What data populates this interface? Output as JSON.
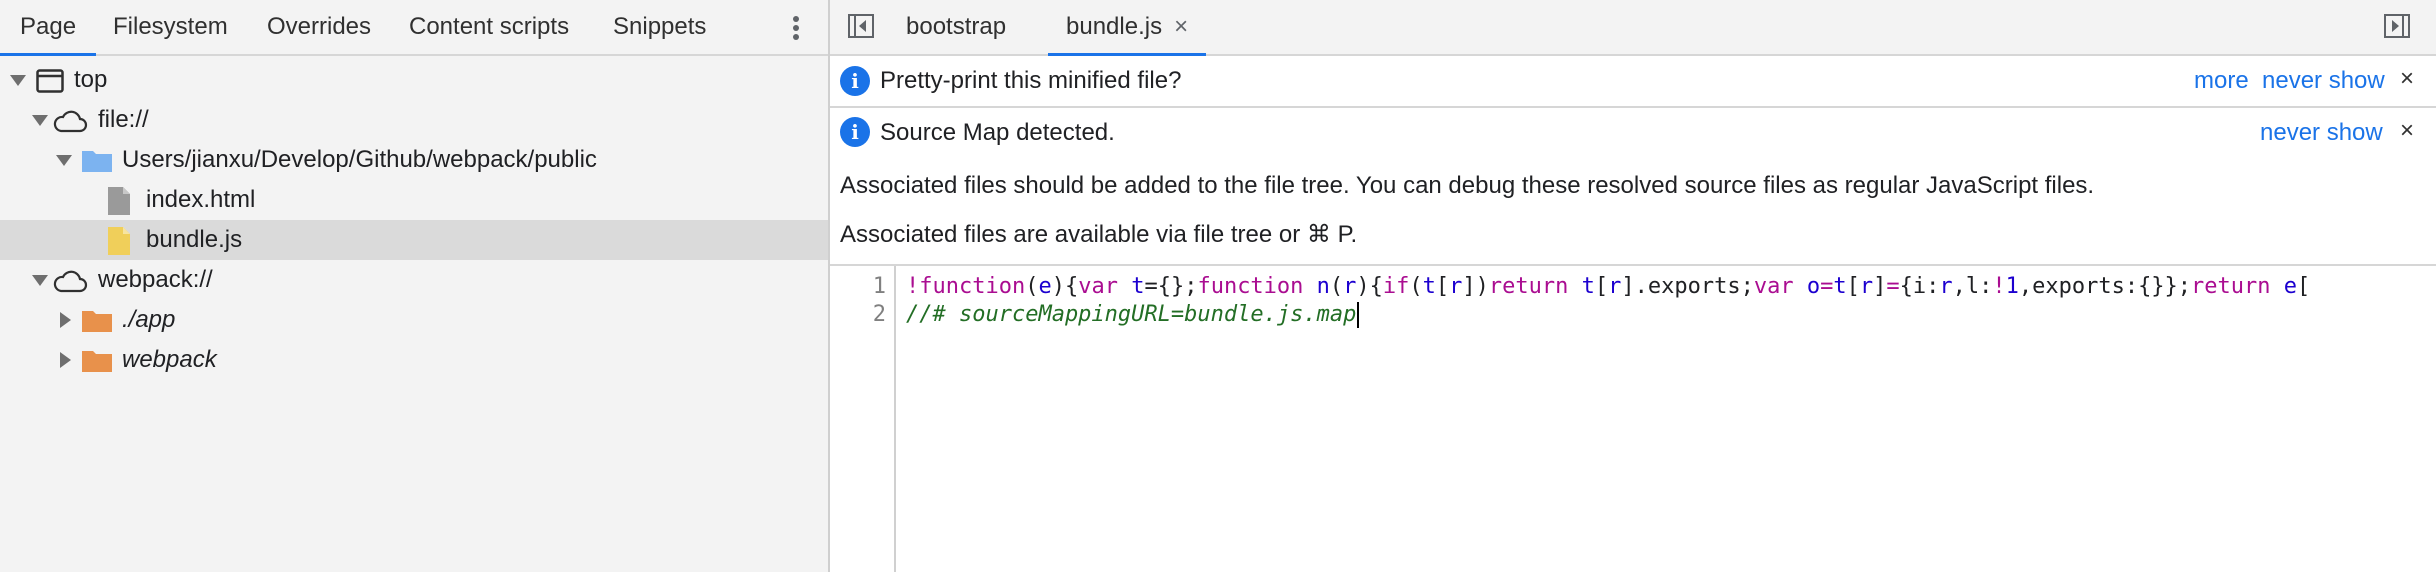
{
  "navigator_tabs": [
    "Page",
    "Filesystem",
    "Overrides",
    "Content scripts",
    "Snippets"
  ],
  "file_tree": {
    "top": "top",
    "file_origin": "file://",
    "folder": "Users/jianxu/Develop/Github/webpack/public",
    "files": [
      "index.html",
      "bundle.js"
    ],
    "selected_file": "bundle.js",
    "webpack_origin": "webpack://",
    "webpack_folders": [
      "./app",
      "webpack"
    ]
  },
  "editor_tabs": {
    "tabs": [
      "bootstrap",
      "bundle.js"
    ],
    "active": "bundle.js",
    "close_symbol": "×"
  },
  "infobars": {
    "pretty_print": {
      "text": "Pretty-print this minified file?",
      "more": "more",
      "never_show": "never show",
      "close": "×"
    },
    "source_map": {
      "text": "Source Map detected.",
      "never_show": "never show",
      "close": "×",
      "detail_1": "Associated files should be added to the file tree. You can debug these resolved source files as regular JavaScript files.",
      "detail_2": "Associated files are available via file tree or ⌘ P."
    }
  },
  "code": {
    "line_numbers": [
      "1",
      "2"
    ],
    "line1_tokens": [
      {
        "t": "!",
        "c": "kw"
      },
      {
        "t": "function",
        "c": "kw"
      },
      {
        "t": "(",
        "c": "pu"
      },
      {
        "t": "e",
        "c": "id"
      },
      {
        "t": "){",
        "c": "pu"
      },
      {
        "t": "var",
        "c": "kw"
      },
      {
        "t": " ",
        "c": "pu"
      },
      {
        "t": "t",
        "c": "id"
      },
      {
        "t": "={};",
        "c": "pu"
      },
      {
        "t": "function",
        "c": "kw"
      },
      {
        "t": " ",
        "c": "pu"
      },
      {
        "t": "n",
        "c": "id"
      },
      {
        "t": "(",
        "c": "pu"
      },
      {
        "t": "r",
        "c": "id"
      },
      {
        "t": "){",
        "c": "pu"
      },
      {
        "t": "if",
        "c": "kw"
      },
      {
        "t": "(",
        "c": "pu"
      },
      {
        "t": "t",
        "c": "id"
      },
      {
        "t": "[",
        "c": "pu"
      },
      {
        "t": "r",
        "c": "id"
      },
      {
        "t": "])",
        "c": "pu"
      },
      {
        "t": "return",
        "c": "kw"
      },
      {
        "t": " ",
        "c": "pu"
      },
      {
        "t": "t",
        "c": "id"
      },
      {
        "t": "[",
        "c": "pu"
      },
      {
        "t": "r",
        "c": "id"
      },
      {
        "t": "].exports;",
        "c": "pu"
      },
      {
        "t": "var",
        "c": "kw"
      },
      {
        "t": " ",
        "c": "pu"
      },
      {
        "t": "o",
        "c": "id"
      },
      {
        "t": "=",
        "c": "kw"
      },
      {
        "t": "t",
        "c": "id"
      },
      {
        "t": "[",
        "c": "pu"
      },
      {
        "t": "r",
        "c": "id"
      },
      {
        "t": "]",
        "c": "pu"
      },
      {
        "t": "=",
        "c": "kw"
      },
      {
        "t": "{i:",
        "c": "pu"
      },
      {
        "t": "r",
        "c": "id"
      },
      {
        "t": ",l:",
        "c": "pu"
      },
      {
        "t": "!",
        "c": "kw"
      },
      {
        "t": "1",
        "c": "nu"
      },
      {
        "t": ",exports:{}};",
        "c": "pu"
      },
      {
        "t": "return",
        "c": "kw"
      },
      {
        "t": " ",
        "c": "pu"
      },
      {
        "t": "e",
        "c": "id"
      },
      {
        "t": "[",
        "c": "pu"
      }
    ],
    "line2": "//# sourceMappingURL=bundle.js.map"
  },
  "colors": {
    "accent": "#1a73e8",
    "folder_blue": "#7cb3f0",
    "folder_orange": "#e8914b",
    "file_gray": "#9a9a9a",
    "file_yellow": "#f0cf5a",
    "keyword": "#aa0d91",
    "identifier": "#1c00cf",
    "comment": "#236e25"
  },
  "icons": [
    "frame-icon",
    "cloud-icon",
    "folder-icon",
    "file-icon",
    "kebab-menu-icon",
    "toggle-navigator-icon",
    "toggle-debugger-icon",
    "info-icon",
    "close-icon"
  ]
}
